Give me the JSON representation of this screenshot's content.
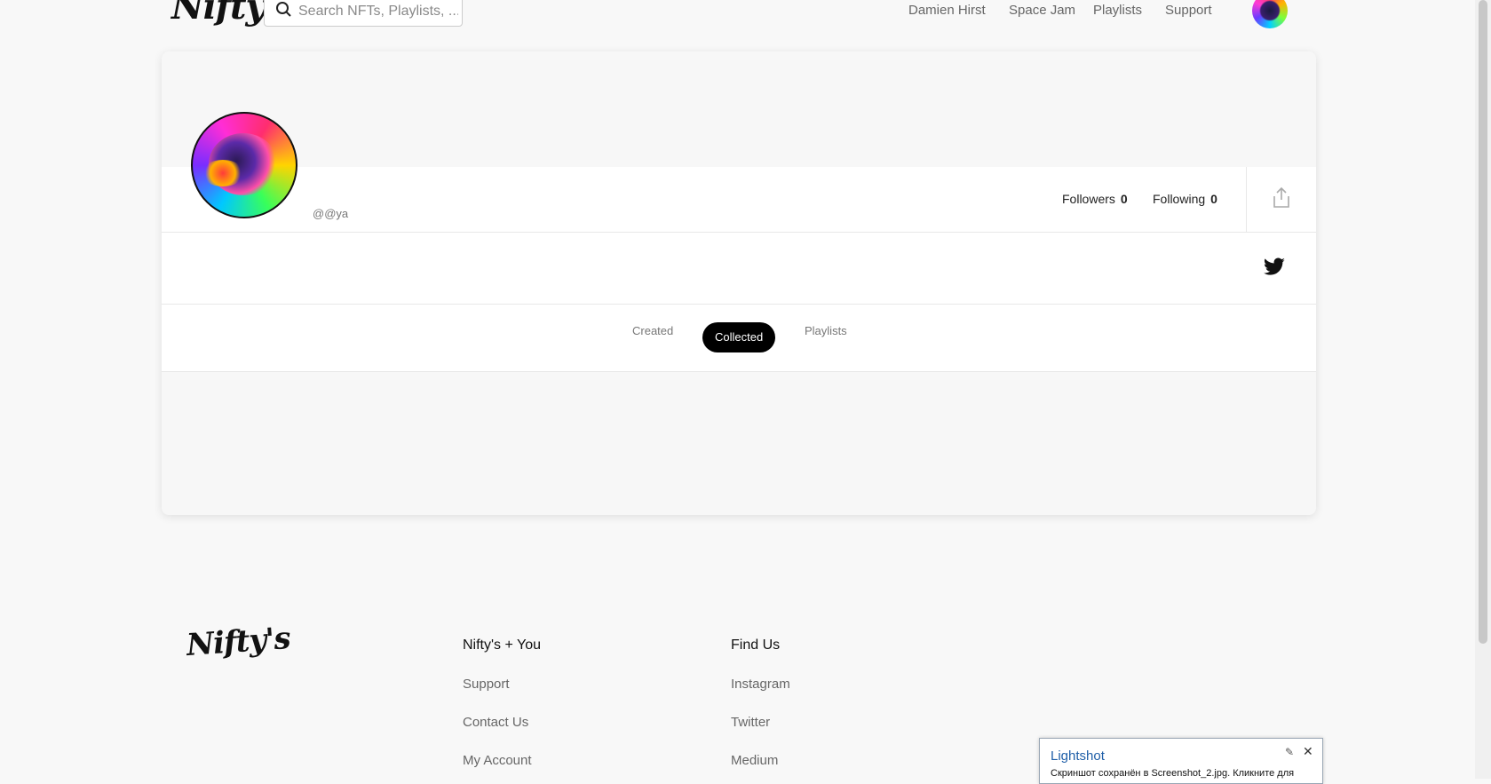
{
  "header": {
    "logo_text": "Nifty's",
    "search_placeholder": "Search NFTs, Playlists, ...",
    "nav": [
      "Damien Hirst",
      "Space Jam",
      "Playlists",
      "Support"
    ]
  },
  "profile": {
    "username": "@@ya",
    "followers_label": "Followers",
    "followers_count": "0",
    "following_label": "Following",
    "following_count": "0"
  },
  "tabs": [
    "Created",
    "Collected",
    "Playlists"
  ],
  "active_tab": "Collected",
  "footer": {
    "logo_text": "Nifty's",
    "col1_heading": "Nifty's + You",
    "col1_links": [
      "Support",
      "Contact Us",
      "My Account"
    ],
    "col2_heading": "Find Us",
    "col2_links": [
      "Instagram",
      "Twitter",
      "Medium"
    ]
  },
  "popup": {
    "title": "Lightshot",
    "message": "Скриншот сохранён в Screenshot_2.jpg. Кликните для"
  },
  "icons": [
    "search-icon",
    "share-icon",
    "twitter-icon",
    "pin-icon",
    "close-icon"
  ]
}
